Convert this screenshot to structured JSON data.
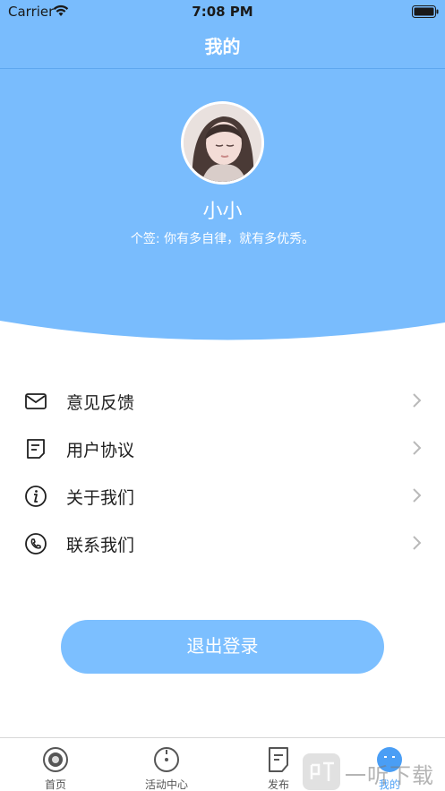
{
  "status_bar": {
    "carrier": "Carrier",
    "time": "7:08 PM"
  },
  "navbar": {
    "title": "我的"
  },
  "profile": {
    "username": "小小",
    "signature": "个签: 你有多自律，就有多优秀。"
  },
  "menu": {
    "items": [
      {
        "label": "意见反馈",
        "icon": "mail-icon"
      },
      {
        "label": "用户协议",
        "icon": "document-icon"
      },
      {
        "label": "关于我们",
        "icon": "info-icon"
      },
      {
        "label": "联系我们",
        "icon": "phone-icon"
      }
    ]
  },
  "logout": {
    "label": "退出登录"
  },
  "tabbar": {
    "tabs": [
      {
        "label": "首页",
        "icon": "home-icon",
        "active": false
      },
      {
        "label": "活动中心",
        "icon": "activity-icon",
        "active": false
      },
      {
        "label": "发布",
        "icon": "publish-icon",
        "active": false
      },
      {
        "label": "我的",
        "icon": "profile-icon",
        "active": true
      }
    ]
  },
  "watermark": {
    "text": "一听下载"
  },
  "colors": {
    "primary": "#7cbfff",
    "header_bg": "#79bcfd",
    "text_dark": "#1f1f1f",
    "tab_active": "#4a9ef5"
  }
}
